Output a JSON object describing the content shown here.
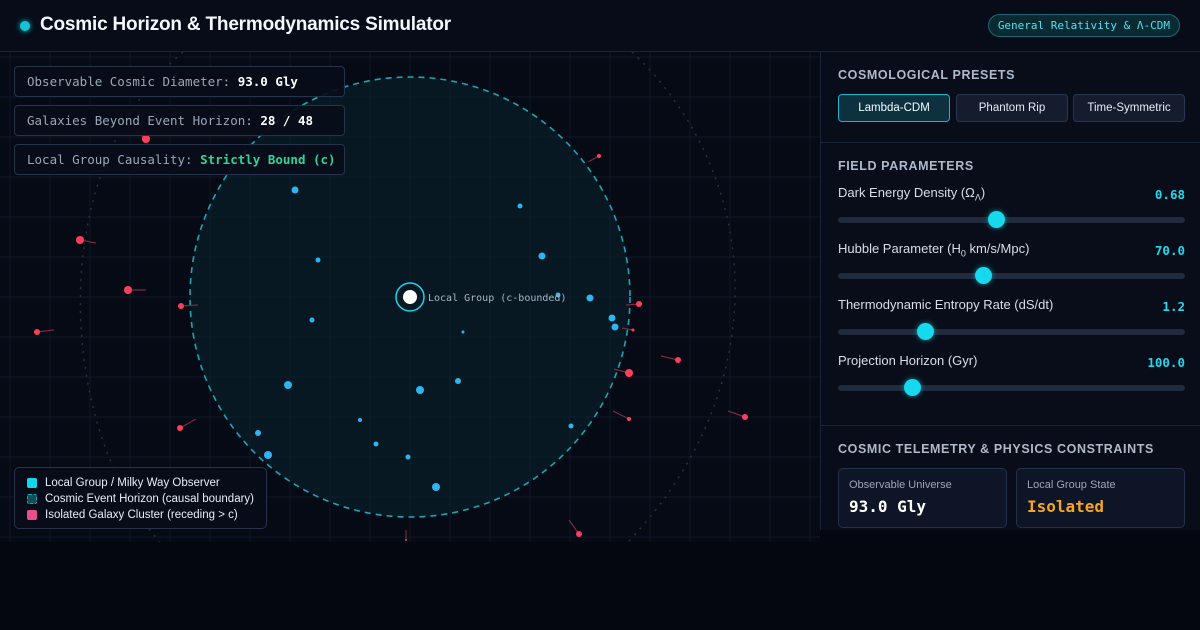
{
  "header": {
    "title": "Cosmic Horizon & Thermodynamics Simulator",
    "badge": "General Relativity & Λ-CDM"
  },
  "readouts": [
    {
      "label": "Observable Cosmic Diameter:",
      "value": "93.0 Gly"
    },
    {
      "label": "Galaxies Beyond Event Horizon:",
      "value": "28 / 48"
    },
    {
      "label": "Local Group Causality:",
      "value": "Strictly Bound (c)"
    }
  ],
  "viewport": {
    "observer_label": "Local Group (c-bounded)"
  },
  "legend": [
    {
      "label": "Local Group / Milky Way Observer",
      "color": "#12d6ea"
    },
    {
      "label": "Cosmic Event Horizon (causal boundary)",
      "color": "#0f4f5a"
    },
    {
      "label": "Isolated Galaxy Cluster (receding > c)",
      "color": "#e94f8a"
    }
  ],
  "colors": {
    "accent": "#16d9ee",
    "receding_galaxy": "#ff3d5e",
    "bound_galaxy": "#2fb4f0",
    "causal_green": "#2fd49a",
    "warning_orange": "#f5a524"
  },
  "presets": {
    "title": "COSMOLOGICAL PRESETS",
    "items": [
      {
        "label": "Lambda-CDM",
        "active": true
      },
      {
        "label": "Phantom Rip",
        "active": false
      },
      {
        "label": "Time-Symmetric",
        "active": false
      }
    ]
  },
  "params": {
    "title": "FIELD PARAMETERS",
    "dark_energy": {
      "label_main": "Dark Energy Density (Ω",
      "label_sub": "Λ",
      "label_tail": ")",
      "value": "0.68",
      "fraction": 0.455
    },
    "hubble": {
      "label_main": "Hubble Parameter (H",
      "label_sub": "0",
      "label_tail": " km/s/Mpc)",
      "value": "70.0",
      "fraction": 0.419
    },
    "entropy": {
      "label_main": "Thermodynamic Entropy Rate (dS/dt)",
      "value": "1.2",
      "fraction": 0.251
    },
    "projection": {
      "label_main": "Projection Horizon (Gyr)",
      "value": "100.0",
      "fraction": 0.213
    }
  },
  "telemetry": {
    "title": "COSMIC TELEMETRY & PHYSICS CONSTRAINTS",
    "cards": [
      {
        "label": "Observable Universe",
        "value": "93.0 Gly"
      },
      {
        "label": "Local Group State",
        "value": "Isolated"
      }
    ]
  }
}
